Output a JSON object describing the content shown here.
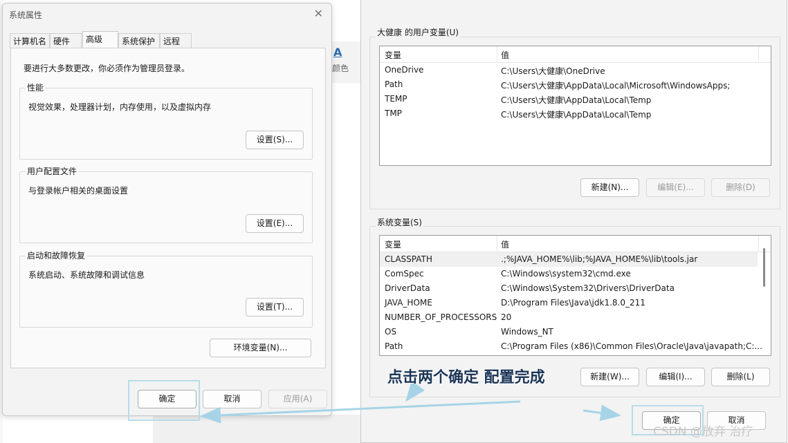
{
  "background": {
    "format_glyph": "A",
    "format_label": "颜色"
  },
  "system_properties": {
    "title": "系统属性",
    "close_glyph": "✕",
    "tabs": [
      "计算机名",
      "硬件",
      "高级",
      "系统保护",
      "远程"
    ],
    "active_tab_index": 2,
    "admin_note": "要进行大多数更改，你必须作为管理员登录。",
    "groups": {
      "performance": {
        "title": "性能",
        "desc": "视觉效果，处理器计划，内存使用，以及虚拟内存",
        "button": "设置(S)..."
      },
      "user_profile": {
        "title": "用户配置文件",
        "desc": "与登录帐户相关的桌面设置",
        "button": "设置(E)..."
      },
      "startup_recovery": {
        "title": "启动和故障恢复",
        "desc": "系统启动、系统故障和调试信息",
        "button": "设置(T)..."
      }
    },
    "env_vars_button": "环境变量(N)...",
    "ok": "确定",
    "cancel": "取消",
    "apply": "应用(A)"
  },
  "environment_variables": {
    "user_section_label": "大健康 的用户变量(U)",
    "col_variable": "变量",
    "col_value": "值",
    "user_vars": [
      {
        "name": "OneDrive",
        "value": "C:\\Users\\大健康\\OneDrive"
      },
      {
        "name": "Path",
        "value": "C:\\Users\\大健康\\AppData\\Local\\Microsoft\\WindowsApps;"
      },
      {
        "name": "TEMP",
        "value": "C:\\Users\\大健康\\AppData\\Local\\Temp"
      },
      {
        "name": "TMP",
        "value": "C:\\Users\\大健康\\AppData\\Local\\Temp"
      }
    ],
    "user_buttons": {
      "new": "新建(N)...",
      "edit": "编辑(E)...",
      "delete": "删除(D)"
    },
    "system_section_label": "系统变量(S)",
    "system_vars": [
      {
        "name": "CLASSPATH",
        "value": ".;%JAVA_HOME%\\lib;%JAVA_HOME%\\lib\\tools.jar"
      },
      {
        "name": "ComSpec",
        "value": "C:\\Windows\\system32\\cmd.exe"
      },
      {
        "name": "DriverData",
        "value": "C:\\Windows\\System32\\Drivers\\DriverData"
      },
      {
        "name": "JAVA_HOME",
        "value": "D:\\Program Files\\Java\\jdk1.8.0_211"
      },
      {
        "name": "NUMBER_OF_PROCESSORS",
        "value": "20"
      },
      {
        "name": "OS",
        "value": "Windows_NT"
      },
      {
        "name": "Path",
        "value": "C:\\Program Files (x86)\\Common Files\\Oracle\\Java\\javapath;C:..."
      }
    ],
    "system_buttons": {
      "new": "新建(W)...",
      "edit": "编辑(I)...",
      "delete": "删除(L)"
    },
    "ok": "确定",
    "cancel": "取消"
  },
  "annotation": {
    "text": "点击两个确定  配置完成",
    "color": "#1c3557",
    "highlight_color": "#b6dcea"
  },
  "watermark": "CSDN @放弃    治疗"
}
